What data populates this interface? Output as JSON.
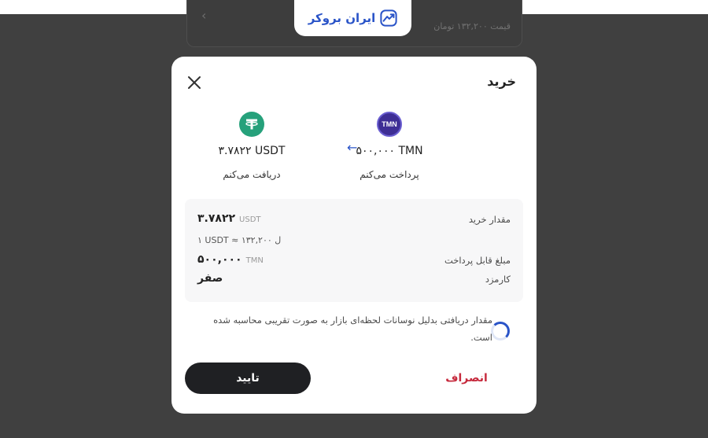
{
  "background": {
    "price_text": "قیمت ۱۳۲,۲۰۰ تومان",
    "chevron": "‹"
  },
  "logo": {
    "text": "ایران بروکر",
    "icon": "trend-chart-icon",
    "color": "#2a54c8"
  },
  "modal": {
    "title": "خرید",
    "pay": {
      "coin_icon_text": "TMN",
      "amount": "۵۰۰,۰۰۰ TMN",
      "label": "پرداخت می‌کنم"
    },
    "receive": {
      "coin_icon": "tether-icon",
      "amount": "۳.۷۸۲۲ USDT",
      "label": "دریافت می‌کنم"
    },
    "arrow": "←",
    "summary": {
      "purchase_amount_label": "مقدار خرید",
      "purchase_amount_value": "۳.۷۸۲۲",
      "purchase_amount_unit": "USDT",
      "rate": "۱ USDT ≈ ۱۳۲,۲۰۰ ﻝ",
      "payable_label": "مبلغ قابل پرداخت",
      "payable_value": "۵۰۰,۰۰۰",
      "payable_unit": "TMN",
      "fee_label": "کارمزد",
      "fee_value": "صفر"
    },
    "notice": "مقدار دریافتی بدلیل نوسانات لحظه‌ای بازار به صورت تقریبی محاسبه شده است.",
    "confirm_label": "تایید",
    "cancel_label": "انصراف"
  },
  "colors": {
    "accent": "#2a54c8",
    "danger": "#c62a3d",
    "dark_button": "#1f2023",
    "usdt": "#26a17b",
    "tmn": "#3e2e95"
  }
}
